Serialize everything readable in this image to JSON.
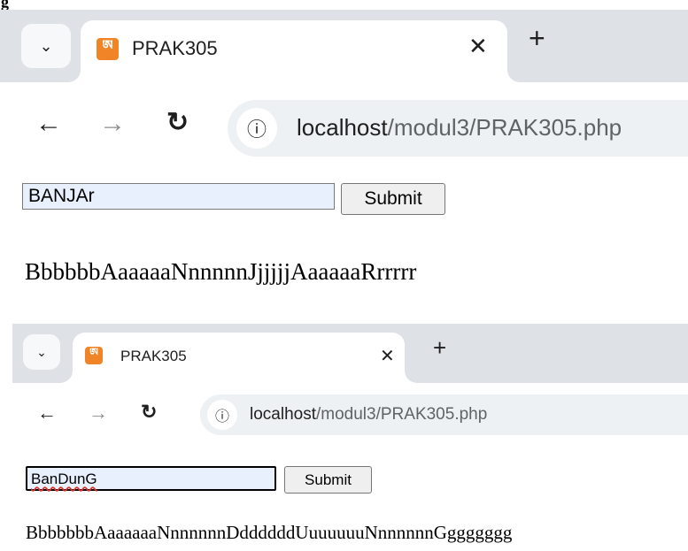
{
  "top_fragment": {
    "text": "g"
  },
  "screenshot_a": {
    "tab": {
      "title": "PRAK305",
      "favicon_glyph": "ཨ"
    },
    "address_bar": {
      "host": "localhost",
      "path": "/modul3/PRAK305.php"
    },
    "form": {
      "input_value": "BANJAr",
      "submit_label": "Submit"
    },
    "result": "BbbbbbAaaaaaNnnnnnJjjjjjAaaaaaRrrrrr"
  },
  "screenshot_b": {
    "tab": {
      "title": "PRAK305",
      "favicon_glyph": "ཨ"
    },
    "address_bar": {
      "host": "localhost",
      "path": "/modul3/PRAK305.php"
    },
    "form": {
      "input_value": "BanDunG",
      "submit_label": "Submit"
    },
    "result": "BbbbbbbAaaaaaaNnnnnnnDddddddUuuuuuuNnnnnnnGggggggg"
  },
  "icons": {
    "tab_dropdown": "chevron-down-icon",
    "close": "close-icon",
    "new_tab": "plus-icon",
    "back": "back-arrow-icon",
    "forward": "forward-arrow-icon",
    "reload": "reload-icon",
    "site_info": "info-icon",
    "favicon": "xampp-icon"
  }
}
